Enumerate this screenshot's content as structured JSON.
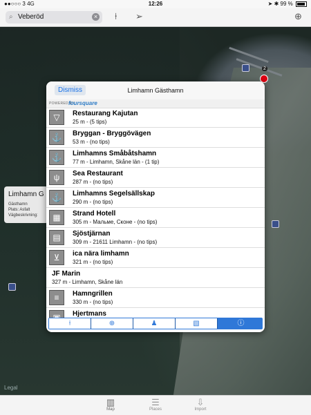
{
  "status": {
    "carrier": "3",
    "network": "4G",
    "time": "12:26",
    "battery": "99 %"
  },
  "search": {
    "value": "Veberöd"
  },
  "popup": {
    "dismiss": "Dismiss",
    "title": "Limhamn Gästhamn",
    "powered_by": "POWERED BY",
    "provider": "foursquare",
    "items": [
      {
        "name": "Restaurang Kajutan",
        "sub": "25 m - (5 tips)",
        "icon": "ice-cream-icon"
      },
      {
        "name": "Bryggan - Bryggövägen",
        "sub": "53 m - (no tips)",
        "icon": "anchor-icon"
      },
      {
        "name": "Limhamns Småbåtshamn",
        "sub": "77 m - Limhamn, Skåne län - (1 tip)",
        "icon": "anchor-icon"
      },
      {
        "name": "Sea Restaurant",
        "sub": "287 m - (no tips)",
        "icon": "fork-knife-icon"
      },
      {
        "name": "Limhamns Segelsällskap",
        "sub": "290 m - (no tips)",
        "icon": "anchor-icon"
      },
      {
        "name": "Strand Hotell",
        "sub": "305 m - Мальме, Сконе - (no tips)",
        "icon": "hotel-icon"
      },
      {
        "name": "Sjöstjärnan",
        "sub": "309 m - 21611 Limhamn - (no tips)",
        "icon": "building-icon"
      },
      {
        "name": "ica nära limhamn",
        "sub": "321 m - (no tips)",
        "icon": "cart-icon"
      },
      {
        "name": "JF Marin",
        "sub": "327 m - Limhamn, Skåne län",
        "icon": ""
      },
      {
        "name": "Hamngrillen",
        "sub": "330 m - (no tips)",
        "icon": "burger-icon"
      },
      {
        "name": "Hjertmans",
        "sub": "",
        "icon": "bag-icon"
      }
    ],
    "tabs": [
      {
        "icon": "pin-icon",
        "glyph": "⍿"
      },
      {
        "icon": "globe-icon",
        "glyph": "⊕"
      },
      {
        "icon": "person-icon",
        "glyph": "♟"
      },
      {
        "icon": "picture-icon",
        "glyph": "▧"
      },
      {
        "icon": "info-icon",
        "glyph": "ⓘ"
      }
    ]
  },
  "callout": {
    "title": "Limhamn G",
    "line1": "Gästhamn",
    "line2": "Plats: Asfalt",
    "line3": "Vägbeskrivning:"
  },
  "map": {
    "badge": "2",
    "legal": "Legal"
  },
  "bottom_tabs": [
    {
      "label": "Map",
      "icon": "map-icon",
      "glyph": "▥"
    },
    {
      "label": "Places",
      "icon": "list-icon",
      "glyph": "☰"
    },
    {
      "label": "Import",
      "icon": "import-icon",
      "glyph": "⇩"
    }
  ]
}
